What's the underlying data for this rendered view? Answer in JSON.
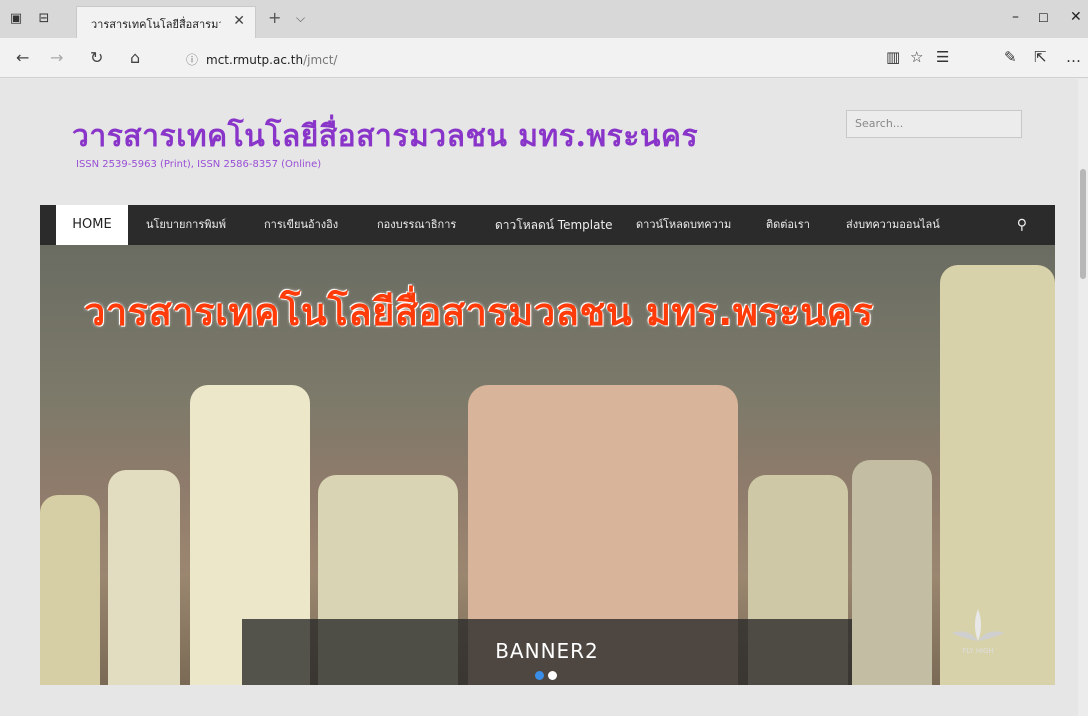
{
  "browser": {
    "tab_title": "วารสารเทคโนโลยีสื่อสารมวล",
    "url_domain": "mct.rmutp.ac.th",
    "url_path": "/jmct/"
  },
  "site": {
    "title": "วารสารเทคโนโลยีสื่อสารมวลชน มทร.พระนคร",
    "issn": "ISSN 2539-5963 (Print), ISSN 2586-8357 (Online)",
    "search_placeholder": "Search..."
  },
  "menu": [
    "HOME",
    "นโยบายการพิมพ์",
    "การเขียนอ้างอิง",
    "กองบรรณาธิการ",
    "ดาวโหลดน์ Template",
    "ดาวน์โหลดบทความ",
    "ติดต่อเรา",
    "ส่งบทความออนไลน์"
  ],
  "banner": {
    "overlay_text": "วารสารเทคโนโลยีสื่อสารมวลชน มทร.พระนคร",
    "caption": "BANNER2",
    "logo_text": "FLY HIGH",
    "active_dot_color": "#3b8ee8"
  }
}
